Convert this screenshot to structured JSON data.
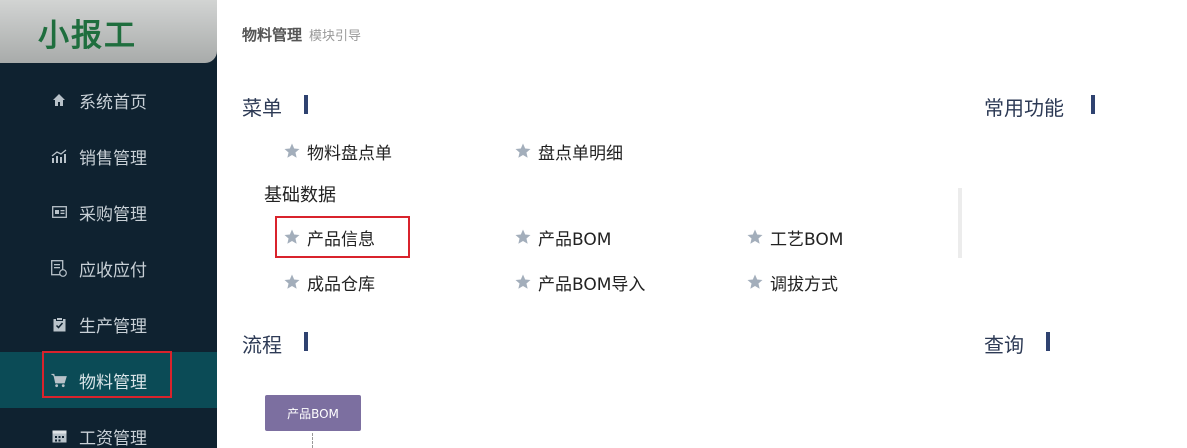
{
  "sidebar": {
    "logo": "小报工",
    "items": [
      {
        "label": "系统首页",
        "icon": "home-icon"
      },
      {
        "label": "销售管理",
        "icon": "chart-icon"
      },
      {
        "label": "采购管理",
        "icon": "card-icon"
      },
      {
        "label": "应收应付",
        "icon": "ledger-icon"
      },
      {
        "label": "生产管理",
        "icon": "clipboard-icon"
      },
      {
        "label": "物料管理",
        "icon": "cart-icon",
        "active": true
      },
      {
        "label": "工资管理",
        "icon": "calendar-icon"
      }
    ]
  },
  "breadcrumb": {
    "main": "物料管理",
    "sub": "模块引导"
  },
  "sections": {
    "menu": "菜单",
    "common": "常用功能",
    "flow": "流程",
    "query": "查询"
  },
  "menu": {
    "top_items": [
      "物料盘点单",
      "盘点单明细"
    ],
    "group_label": "基础数据",
    "row1": [
      "产品信息",
      "产品BOM",
      "工艺BOM"
    ],
    "row2": [
      "成品仓库",
      "产品BOM导入",
      "调拔方式"
    ]
  },
  "flow": {
    "box_label": "产品BOM"
  },
  "colors": {
    "sidebar_bg": "#0f2230",
    "active_bg": "#0b4b56",
    "highlight": "#d9232c",
    "flow_box": "#7c6fa0"
  }
}
